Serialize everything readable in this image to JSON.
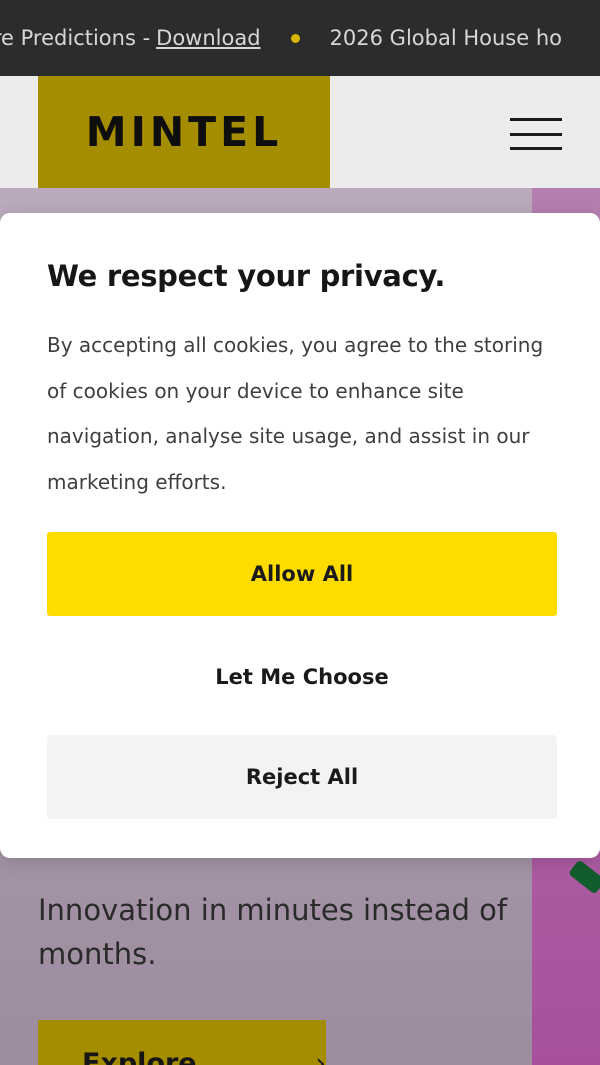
{
  "ticker": {
    "item1_text": "are Predictions - ",
    "item1_link": "Download",
    "item2_text": "2026 Global House ho"
  },
  "header": {
    "logo_text": "MINTEL",
    "menu_icon": "hamburger-menu-icon"
  },
  "hero": {
    "text": "Innovation in minutes instead of months.",
    "cta_label": "Explore now",
    "cta_arrow": "›"
  },
  "cookie_modal": {
    "title": "We respect your privacy.",
    "body": "By accepting all cookies, you agree to the storing of cookies on your device to enhance site navigation, analyse site usage, and assist in our marketing efforts.",
    "allow_all_label": "Allow All",
    "let_me_choose_label": "Let Me Choose",
    "reject_all_label": "Reject All"
  },
  "colors": {
    "ticker_bg": "#2c2c2c",
    "brand_yellow": "#ffdc00",
    "brand_yellow_dimmed": "#a58d00",
    "reject_bg": "#f3f3f3"
  }
}
